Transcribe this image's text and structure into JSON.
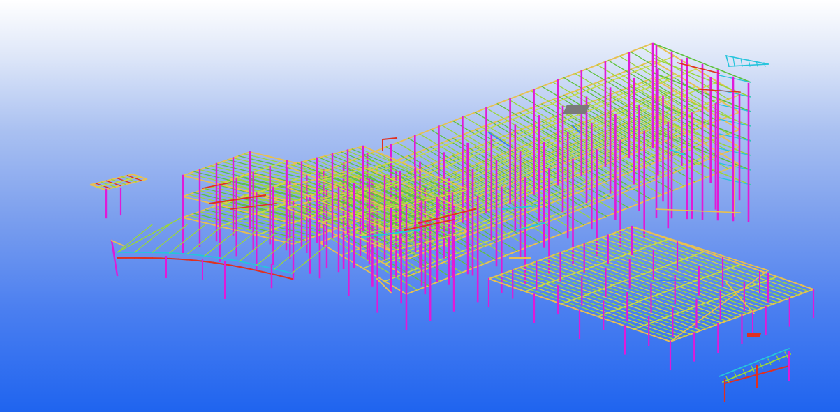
{
  "viewport": {
    "background_top": "#ffffff",
    "background_bottom": "#1f64ef"
  },
  "model": {
    "name": "3d-steel-structure-model",
    "colors": {
      "column": "#e01ad8",
      "beam": "#9ad63a",
      "beam_alt": "#5ec23c",
      "secondary": "#c8d84a",
      "brace": "#26c4dc",
      "edge": "#e8c050",
      "special": "#e03020",
      "slab": "#7a7a7a",
      "bolt": "#3a86e8"
    }
  }
}
